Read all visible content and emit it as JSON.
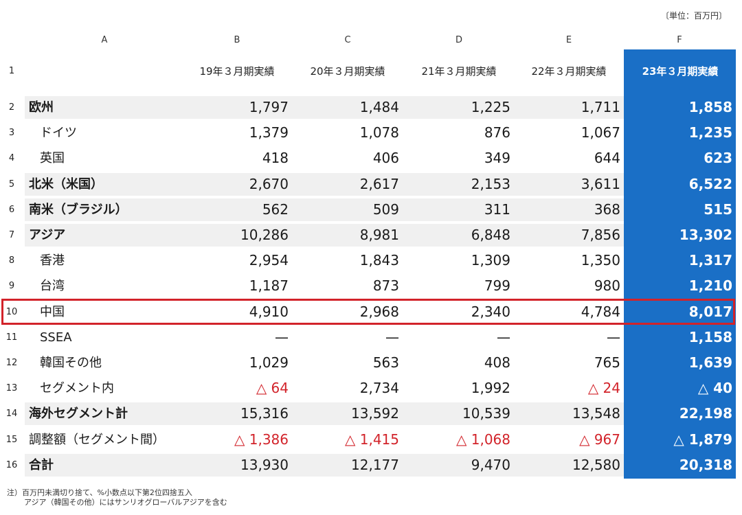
{
  "unit_note": "〔単位：百万円〕",
  "column_letters": [
    "A",
    "B",
    "C",
    "D",
    "E",
    "F"
  ],
  "header_row": {
    "row_number": "1",
    "periods": [
      "19年３月期実績",
      "20年３月期実績",
      "21年３月期実績",
      "22年３月期実績",
      "23年３月期実績"
    ]
  },
  "rows": [
    {
      "row_number": "2",
      "label": "欧州",
      "values": [
        "1,797",
        "1,484",
        "1,225",
        "1,711",
        "1,858"
      ]
    },
    {
      "row_number": "3",
      "label": "ドイツ",
      "values": [
        "1,379",
        "1,078",
        "876",
        "1,067",
        "1,235"
      ]
    },
    {
      "row_number": "4",
      "label": "英国",
      "values": [
        "418",
        "406",
        "349",
        "644",
        "623"
      ]
    },
    {
      "row_number": "5",
      "label": "北米（米国）",
      "values": [
        "2,670",
        "2,617",
        "2,153",
        "3,611",
        "6,522"
      ]
    },
    {
      "row_number": "6",
      "label": "南米（ブラジル）",
      "values": [
        "562",
        "509",
        "311",
        "368",
        "515"
      ]
    },
    {
      "row_number": "7",
      "label": "アジア",
      "values": [
        "10,286",
        "8,981",
        "6,848",
        "7,856",
        "13,302"
      ]
    },
    {
      "row_number": "8",
      "label": "香港",
      "values": [
        "2,954",
        "1,843",
        "1,309",
        "1,350",
        "1,317"
      ]
    },
    {
      "row_number": "9",
      "label": "台湾",
      "values": [
        "1,187",
        "873",
        "799",
        "980",
        "1,210"
      ]
    },
    {
      "row_number": "10",
      "label": "中国",
      "values": [
        "4,910",
        "2,968",
        "2,340",
        "4,784",
        "8,017"
      ]
    },
    {
      "row_number": "11",
      "label": "SSEA",
      "values": [
        "—",
        "—",
        "—",
        "—",
        "1,158"
      ]
    },
    {
      "row_number": "12",
      "label": "韓国その他",
      "values": [
        "1,029",
        "563",
        "408",
        "765",
        "1,639"
      ]
    },
    {
      "row_number": "13",
      "label": "セグメント内",
      "values": [
        "△ 64",
        "2,734",
        "1,992",
        "△ 24",
        "△ 40"
      ]
    },
    {
      "row_number": "14",
      "label": "海外セグメント計",
      "values": [
        "15,316",
        "13,592",
        "10,539",
        "13,548",
        "22,198"
      ]
    },
    {
      "row_number": "15",
      "label": "調整額（セグメント間）",
      "values": [
        "△ 1,386",
        "△ 1,415",
        "△ 1,068",
        "△ 967",
        "△ 1,879"
      ]
    },
    {
      "row_number": "16",
      "label": "合計",
      "values": [
        "13,930",
        "12,177",
        "9,470",
        "12,580",
        "20,318"
      ]
    }
  ],
  "highlighted_row": "中国",
  "colors": {
    "accent_column": "#1a6fc6",
    "negative": "#d2232a",
    "highlight_border": "#d2232a",
    "band": "#f0f0f0"
  },
  "notes": [
    "注）百万円未満切り捨て、%小数点以下第2位四捨五入",
    "アジア（韓国その他）にはサンリオグローバルアジアを含む"
  ]
}
